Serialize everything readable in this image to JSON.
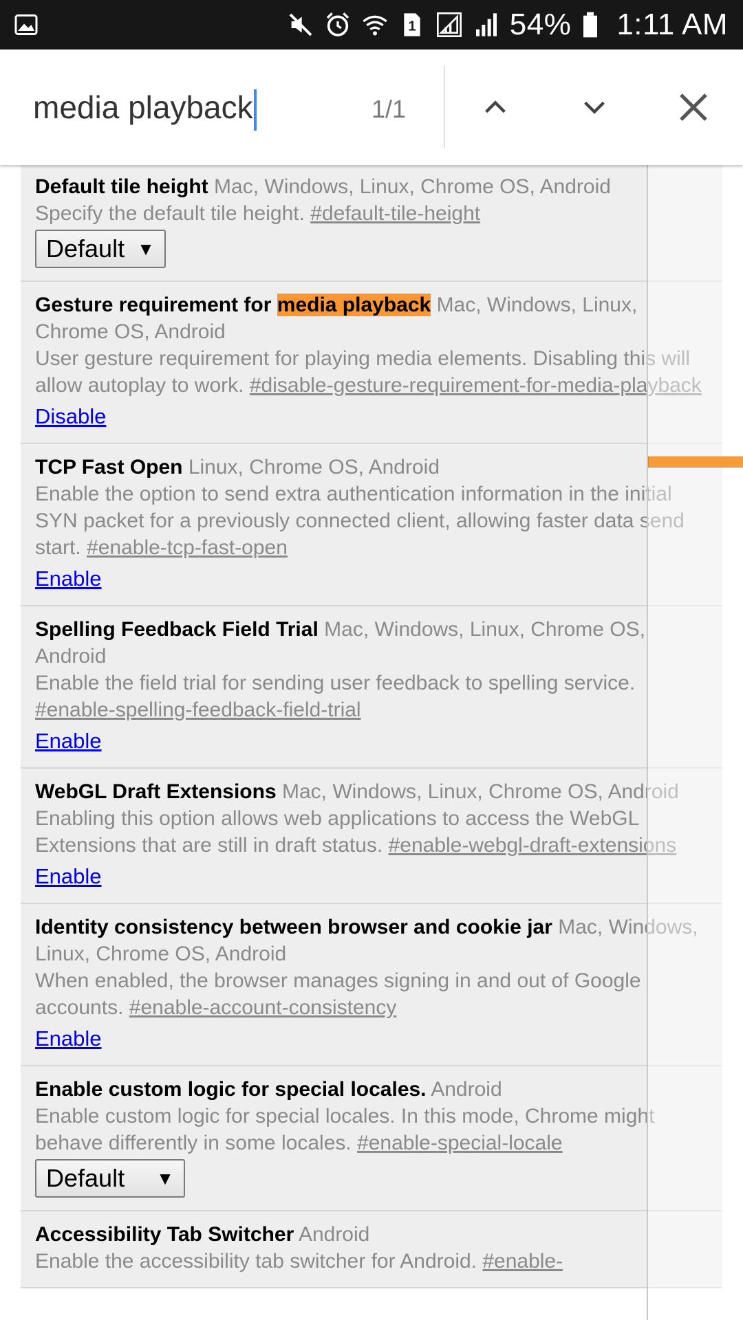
{
  "status_bar": {
    "battery": "54%",
    "time": "1:11 AM",
    "icons": [
      "image-icon",
      "mute-icon",
      "alarm-icon",
      "wifi-icon",
      "sim-icon",
      "signal-icon",
      "signal-bars-icon",
      "battery-icon"
    ],
    "sim_number": "1"
  },
  "find_bar": {
    "query": "media playback",
    "count": "1/1",
    "icons": [
      "chevron-up-icon",
      "chevron-down-icon",
      "close-icon"
    ]
  },
  "colors": {
    "highlight": "#ff9632",
    "link": "#0000ee",
    "caret": "#4285f4"
  },
  "flags": [
    {
      "name": "Default tile height",
      "platforms": "Mac, Windows, Linux, Chrome OS, Android",
      "description": "Specify the default tile height.",
      "anchor": "#default-tile-height",
      "control": "select",
      "value": "Default"
    },
    {
      "name_prefix": "Gesture requirement for ",
      "name_highlight": "media playback",
      "platforms": "Mac, Windows, Linux, Chrome OS, Android",
      "description": "User gesture requirement for playing media elements. Disabling this will allow autoplay to work.",
      "anchor": "#disable-gesture-requirement-for-media-playback",
      "control": "link",
      "value": "Disable"
    },
    {
      "name": "TCP Fast Open",
      "platforms": "Linux, Chrome OS, Android",
      "description": "Enable the option to send extra authentication information in the initial SYN packet for a previously connected client, allowing faster data send start.",
      "anchor": "#enable-tcp-fast-open",
      "control": "link",
      "value": "Enable"
    },
    {
      "name": "Spelling Feedback Field Trial",
      "platforms": "Mac, Windows, Linux, Chrome OS, Android",
      "description": "Enable the field trial for sending user feedback to spelling service.",
      "anchor": "#enable-spelling-feedback-field-trial",
      "control": "link",
      "value": "Enable"
    },
    {
      "name": "WebGL Draft Extensions",
      "platforms": "Mac, Windows, Linux, Chrome OS, Android",
      "description": "Enabling this option allows web applications to access the WebGL Extensions that are still in draft status.",
      "anchor": "#enable-webgl-draft-extensions",
      "control": "link",
      "value": "Enable"
    },
    {
      "name": "Identity consistency between browser and cookie jar",
      "platforms": "Mac, Windows, Linux, Chrome OS, Android",
      "description": "When enabled, the browser manages signing in and out of Google accounts.",
      "anchor": "#enable-account-consistency",
      "control": "link",
      "value": "Enable"
    },
    {
      "name": "Enable custom logic for special locales.",
      "platforms": "Android",
      "description": "Enable custom logic for special locales. In this mode, Chrome might behave differently in some locales.",
      "anchor": "#enable-special-locale",
      "control": "select",
      "value": "Default"
    },
    {
      "name": "Accessibility Tab Switcher",
      "platforms": "Android",
      "description": "Enable the accessibility tab switcher for Android.",
      "anchor": "#enable-",
      "control": "none",
      "value": ""
    }
  ]
}
